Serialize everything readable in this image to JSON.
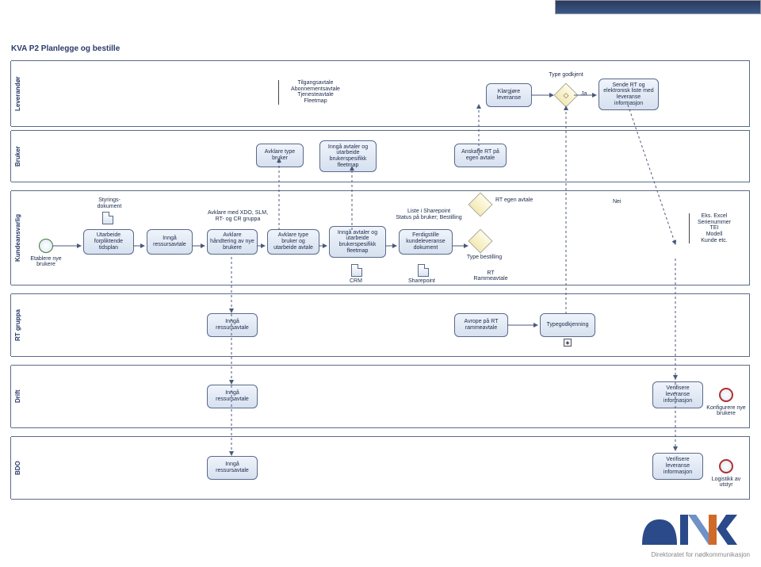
{
  "title": "KVA P2 Planlegge og bestille",
  "lanes": {
    "lev": "Leverandør",
    "bru": "Bruker",
    "kun": "Kundeansvarlig",
    "rtg": "RT gruppa",
    "dri": "Drift",
    "bdo": "BDO"
  },
  "lev": {
    "ann1": "Tilgangsavtale\nAbonnementsavtale\nTjenesteavtale\nFleetmap",
    "t1": "Klargjøre leveranse",
    "g1": "Type godkjent",
    "ja": "Ja",
    "t2": "Sende RT og elektronisk liste med leveranse informasjon"
  },
  "bru": {
    "t1": "Avklare type bruker",
    "t2": "Inngå avtaler og utarbeide brukerspesifikk fleetmap",
    "t3": "Anskaffe RT på egen avtale"
  },
  "kun": {
    "start": "Etablere nye brukere",
    "ann1": "Styrings-\ndokument",
    "t1": "Utarbeide forpliktende tidsplan",
    "t2": "Inngå ressursavtale",
    "ann2": "Avklare med XDO, SLM,\nRT- og CR gruppa",
    "t3": "Avklare håndtering av nye brukere",
    "t4": "Avklare type bruker og utarbeide avtale",
    "t5": "Inngå avtaler og utarbeide brukerspesifikk fleetmap",
    "ann3": "Liste i Sharepoint\nStatus på bruker; Bestilling",
    "t6": "Ferdigstille kundeleveranse dokument",
    "g1": "Type bestilling",
    "g2": "RT egen avtale",
    "nei": "Nei",
    "crm": "CRM",
    "sp": "Sharepoint",
    "rtram": "RT\nRammeavtale",
    "ann4": "Eks. Excel\nSerienummer\nTEI\nModell\nKunde etc."
  },
  "rtg": {
    "t1": "Inngå ressursavtale",
    "t2": "Avrope på RT rammeavtale",
    "t3": "Typegodkjenning"
  },
  "dri": {
    "t1": "Inngå ressursavtale",
    "t2": "Verifisere leveranse informasjon",
    "end": "Konfigurere nye brukere"
  },
  "bdo": {
    "t1": "Inngå ressursavtale",
    "t2": "Verifisere leveranse informasjon",
    "end": "Logistikk av utstyr"
  },
  "logo": {
    "name": "dNk",
    "sub": "Direktoratet for nødkommunikasjon"
  }
}
